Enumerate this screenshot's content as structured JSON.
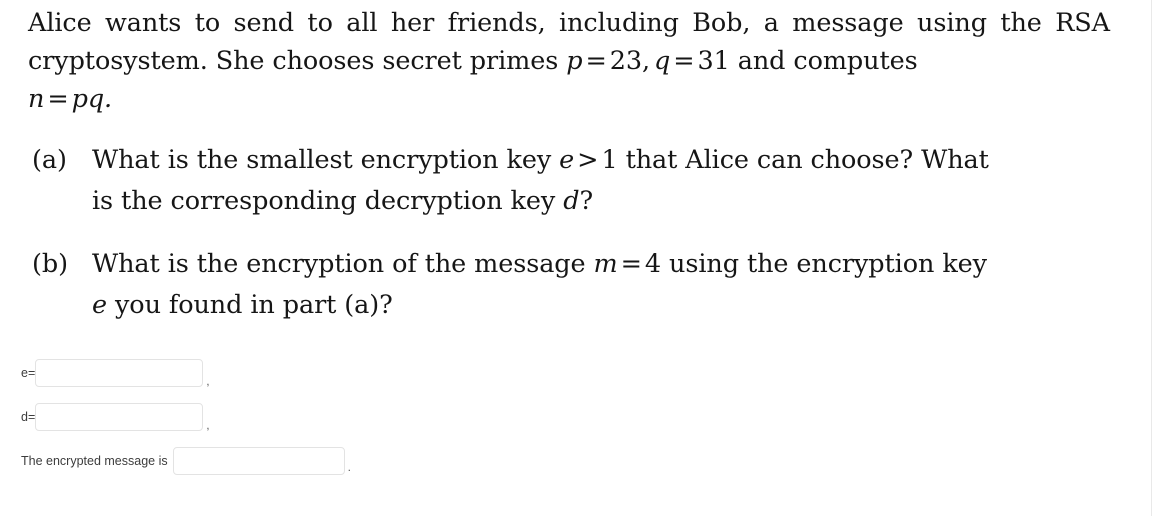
{
  "problem": {
    "intro": {
      "line1": "Alice wants to send to all her friends, including Bob, a message using the",
      "line2_pre": "RSA cryptosystem. She chooses secret primes ",
      "math_p_var": "p",
      "math_eq1": "=",
      "math_p_val": "23,",
      "math_q_var": "q",
      "math_eq2": "=",
      "math_q_val": "31",
      "line2_post": " and computes",
      "line3_n": "n",
      "line3_eq": "=",
      "line3_pq": "pq."
    },
    "items": [
      {
        "marker": "(a)",
        "text_pre": "What is the smallest encryption key ",
        "var1": "e",
        "op": ">",
        "num": "1",
        "text_mid": " that Alice can choose? What",
        "text_post_pre": "is the corresponding decryption key ",
        "var2": "d",
        "text_post_end": "?"
      },
      {
        "marker": "(b)",
        "text_pre": "What is the encryption of the message ",
        "var1": "m",
        "op": "=",
        "num": "4",
        "text_mid": " using the encryption key",
        "var2": "e",
        "text_post_end": " you found in part (a)?"
      }
    ]
  },
  "answers": {
    "e": {
      "label": "e=",
      "value": "",
      "placeholder": "",
      "trailing": ","
    },
    "d": {
      "label": "d=",
      "value": "",
      "placeholder": "",
      "trailing": ","
    },
    "message": {
      "label": "The encrypted message is",
      "value": "",
      "placeholder": "",
      "trailing": "."
    }
  },
  "colors": {
    "text": "#161616",
    "label_text": "#3d3d3d",
    "input_border": "#e3e3e3",
    "background": "#ffffff",
    "edge_line": "#e9e9e9"
  }
}
